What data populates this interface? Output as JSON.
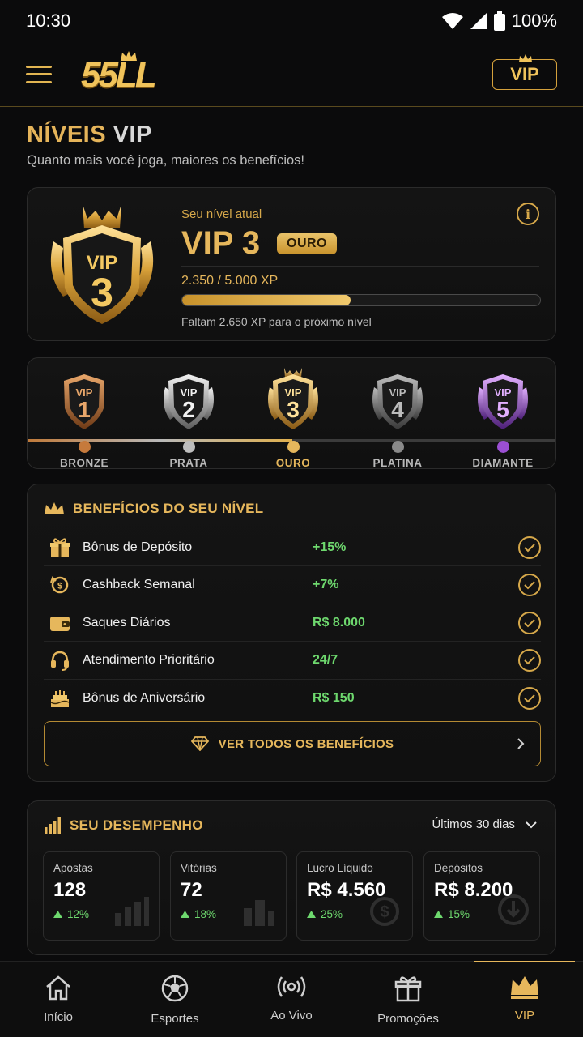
{
  "status_bar": {
    "time": "10:30",
    "battery": "100%"
  },
  "header": {
    "logo_text": "55LL",
    "vip_button": "VIP"
  },
  "page": {
    "title_part1": "NÍVEIS",
    "title_part2": "VIP",
    "subtitle": "Quanto mais você joga, maiores os benefícios!"
  },
  "current_level": {
    "label": "Seu nível atual",
    "level": "VIP 3",
    "tier": "OURO",
    "emblem_top": "VIP",
    "emblem_number": "3",
    "xp_text": "2.350 / 5.000 XP",
    "xp_progress": 0.47,
    "remaining": "Faltam 2.650 XP para o próximo nível"
  },
  "tiers": [
    {
      "label": "VIP",
      "number": "1",
      "name": "BRONZE",
      "color": "#c67a3c"
    },
    {
      "label": "VIP",
      "number": "2",
      "name": "PRATA",
      "color": "#bdbdbd"
    },
    {
      "label": "VIP",
      "number": "3",
      "name": "OURO",
      "color": "#e6b75c"
    },
    {
      "label": "VIP",
      "number": "4",
      "name": "PLATINA",
      "color": "#8a8a8a"
    },
    {
      "label": "VIP",
      "number": "5",
      "name": "DIAMANTE",
      "color": "#9b4fd3"
    }
  ],
  "benefits": {
    "title": "BENEFÍCIOS DO SEU NÍVEL",
    "items": [
      {
        "icon": "gift-icon",
        "name": "Bônus de Depósito",
        "value": "+15%"
      },
      {
        "icon": "cashback-icon",
        "name": "Cashback Semanal",
        "value": "+7%"
      },
      {
        "icon": "wallet-icon",
        "name": "Saques Diários",
        "value": "R$ 8.000"
      },
      {
        "icon": "headset-icon",
        "name": "Atendimento Prioritário",
        "value": "24/7"
      },
      {
        "icon": "cake-icon",
        "name": "Bônus de Aniversário",
        "value": "R$ 150"
      }
    ],
    "see_all": "VER TODOS OS BENEFÍCIOS"
  },
  "performance": {
    "title": "SEU DESEMPENHO",
    "period": "Últimos 30 dias",
    "stats": [
      {
        "label": "Apostas",
        "value": "128",
        "delta": "12%"
      },
      {
        "label": "Vitórias",
        "value": "72",
        "delta": "18%"
      },
      {
        "label": "Lucro Líquido",
        "value": "R$ 4.560",
        "delta": "25%"
      },
      {
        "label": "Depósitos",
        "value": "R$ 8.200",
        "delta": "15%"
      }
    ]
  },
  "bottom_nav": [
    {
      "icon": "home-icon",
      "label": "Início"
    },
    {
      "icon": "soccer-ball-icon",
      "label": "Esportes"
    },
    {
      "icon": "live-broadcast-icon",
      "label": "Ao Vivo"
    },
    {
      "icon": "gift-icon",
      "label": "Promoções"
    },
    {
      "icon": "crown-icon",
      "label": "VIP"
    }
  ],
  "colors": {
    "gold": "#e6b75c",
    "green": "#6ed86e",
    "background": "#0b0b0c"
  }
}
